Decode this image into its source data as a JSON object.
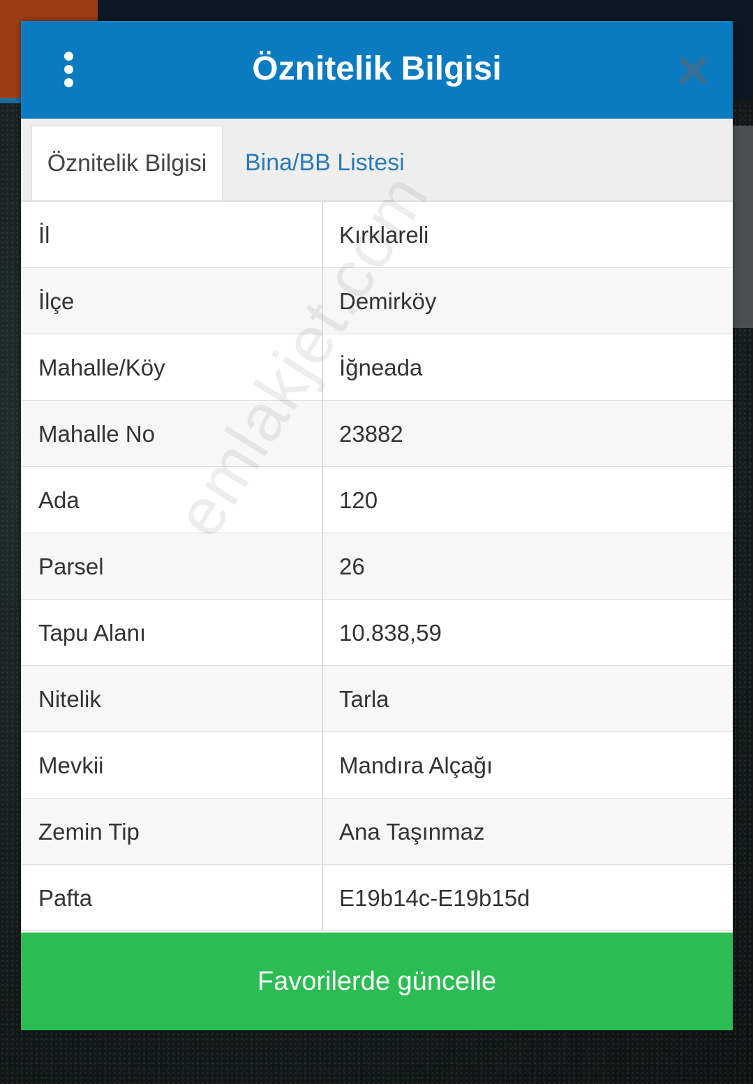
{
  "modal": {
    "title": "Öznitelik Bilgisi"
  },
  "tabs": [
    {
      "label": "Öznitelik Bilgisi",
      "active": true
    },
    {
      "label": "Bina/BB Listesi",
      "active": false
    }
  ],
  "attributes": [
    {
      "label": "İl",
      "value": "Kırklareli"
    },
    {
      "label": "İlçe",
      "value": "Demirköy"
    },
    {
      "label": "Mahalle/Köy",
      "value": "İğneada"
    },
    {
      "label": "Mahalle No",
      "value": "23882"
    },
    {
      "label": "Ada",
      "value": "120"
    },
    {
      "label": "Parsel",
      "value": "26"
    },
    {
      "label": "Tapu Alanı",
      "value": "10.838,59"
    },
    {
      "label": "Nitelik",
      "value": "Tarla"
    },
    {
      "label": "Mevkii",
      "value": "Mandıra Alçağı"
    },
    {
      "label": "Zemin Tip",
      "value": "Ana Taşınmaz"
    },
    {
      "label": "Pafta",
      "value": "E19b14c-E19b15d"
    }
  ],
  "footer": {
    "button_label": "Favorilerde güncelle"
  },
  "watermark": "emlakjet.com",
  "colors": {
    "header": "#0a7bc1",
    "tab_link": "#2a7ab8",
    "footer_button": "#2bbd53"
  }
}
